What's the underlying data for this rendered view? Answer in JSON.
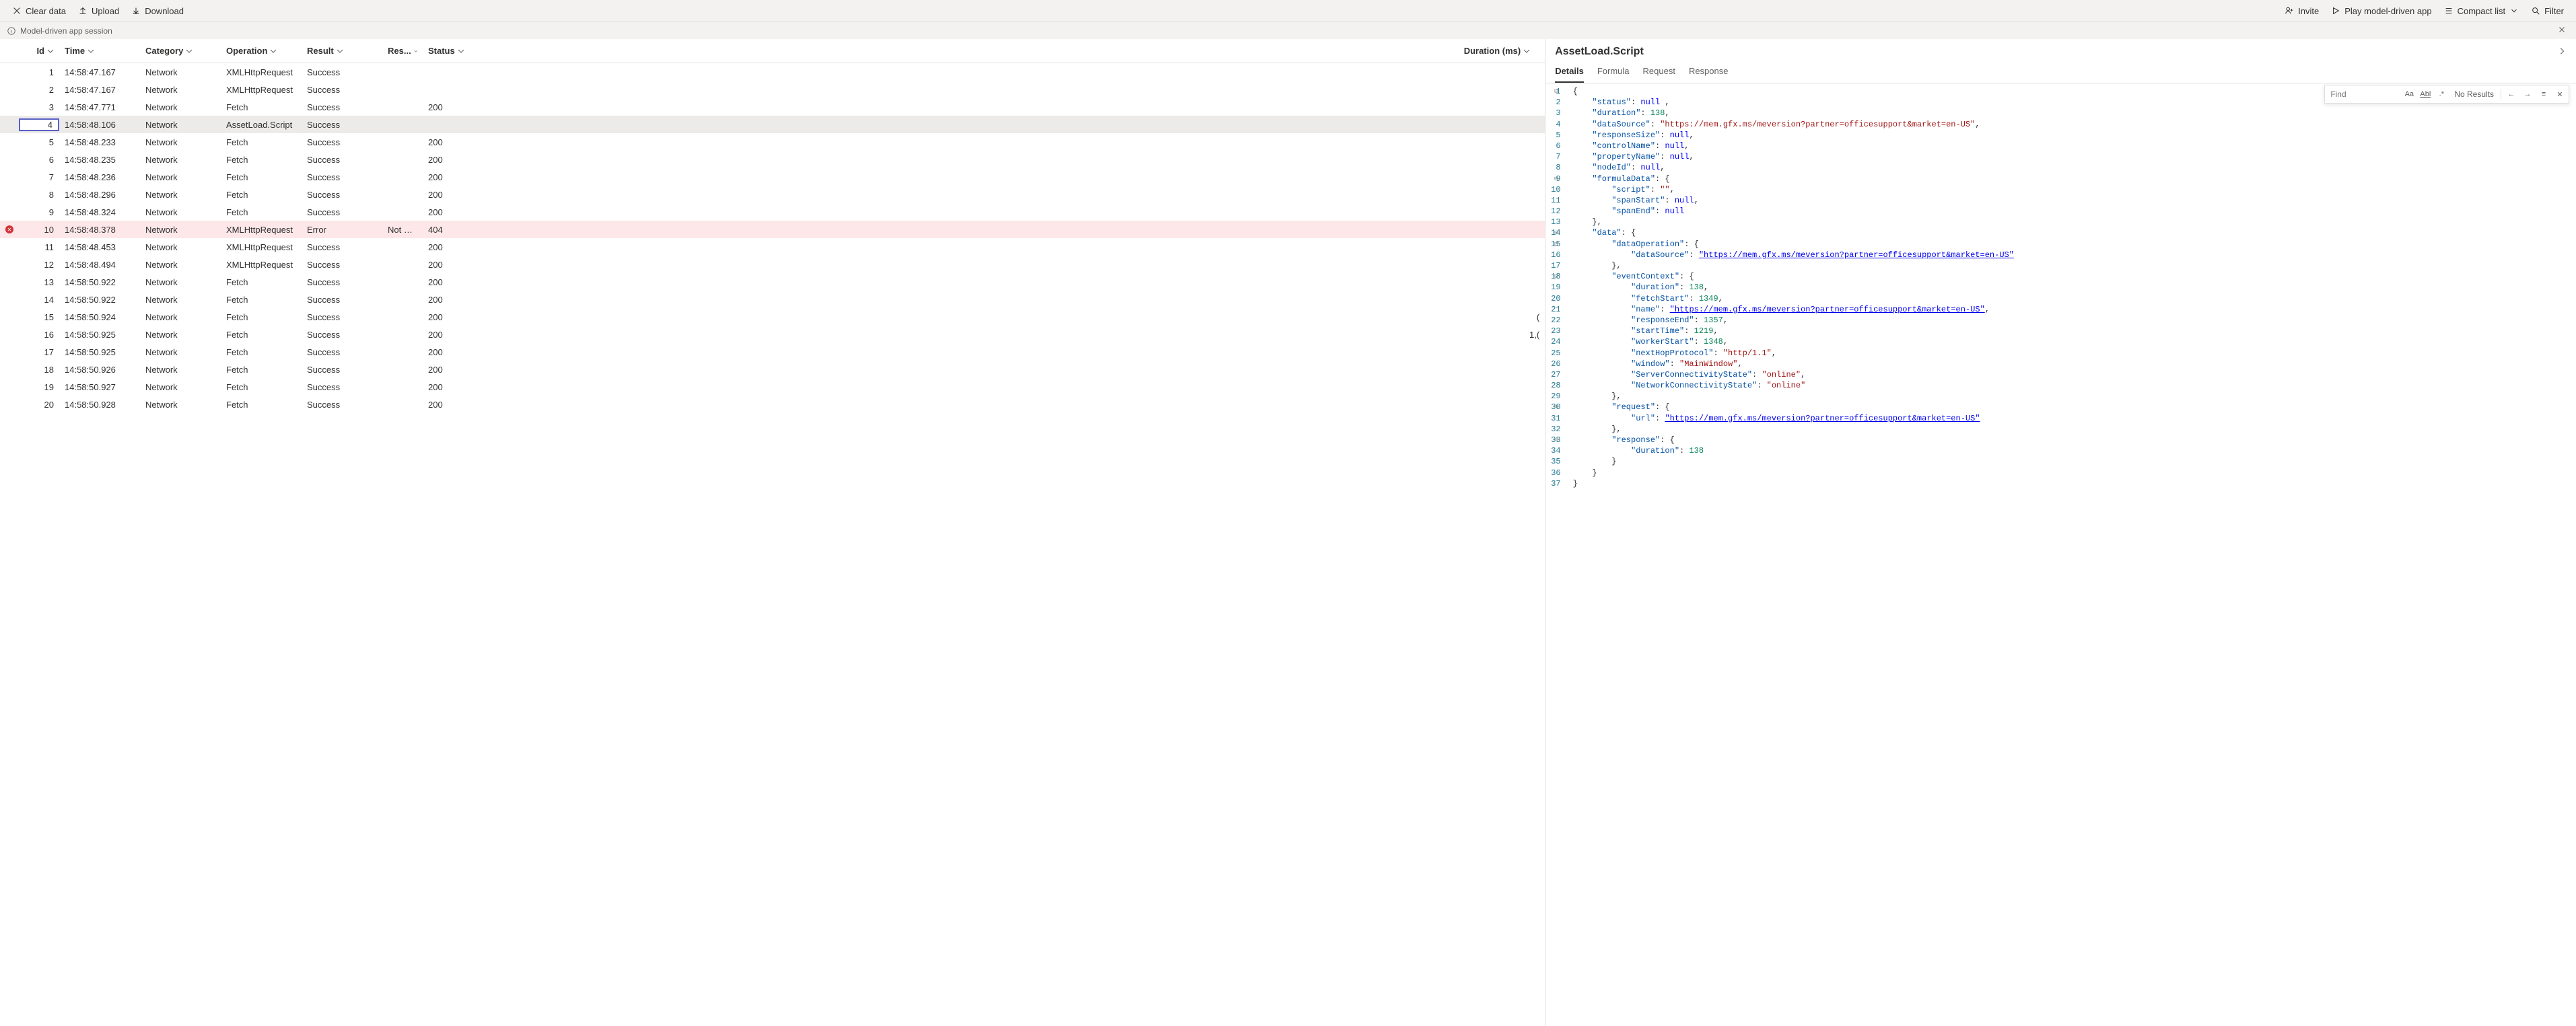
{
  "toolbar": {
    "clear": "Clear data",
    "upload": "Upload",
    "download": "Download",
    "invite": "Invite",
    "play": "Play model-driven app",
    "compact": "Compact list",
    "filter": "Filter"
  },
  "session": {
    "label": "Model-driven app session"
  },
  "columns": {
    "id": "Id",
    "time": "Time",
    "category": "Category",
    "operation": "Operation",
    "result": "Result",
    "res": "Res...",
    "status": "Status",
    "duration": "Duration (ms)"
  },
  "rows": [
    {
      "id": 1,
      "time": "14:58:47.167",
      "category": "Network",
      "operation": "XMLHttpRequest",
      "result": "Success",
      "status": "",
      "duration": "",
      "err": false
    },
    {
      "id": 2,
      "time": "14:58:47.167",
      "category": "Network",
      "operation": "XMLHttpRequest",
      "result": "Success",
      "status": "",
      "duration": "",
      "err": false
    },
    {
      "id": 3,
      "time": "14:58:47.771",
      "category": "Network",
      "operation": "Fetch",
      "result": "Success",
      "status": "200",
      "duration": "",
      "err": false
    },
    {
      "id": 4,
      "time": "14:58:48.106",
      "category": "Network",
      "operation": "AssetLoad.Script",
      "result": "Success",
      "status": "",
      "duration": "",
      "err": false,
      "selected": true
    },
    {
      "id": 5,
      "time": "14:58:48.233",
      "category": "Network",
      "operation": "Fetch",
      "result": "Success",
      "status": "200",
      "duration": "",
      "err": false
    },
    {
      "id": 6,
      "time": "14:58:48.235",
      "category": "Network",
      "operation": "Fetch",
      "result": "Success",
      "status": "200",
      "duration": "",
      "err": false
    },
    {
      "id": 7,
      "time": "14:58:48.236",
      "category": "Network",
      "operation": "Fetch",
      "result": "Success",
      "status": "200",
      "duration": "",
      "err": false
    },
    {
      "id": 8,
      "time": "14:58:48.296",
      "category": "Network",
      "operation": "Fetch",
      "result": "Success",
      "status": "200",
      "duration": "",
      "err": false
    },
    {
      "id": 9,
      "time": "14:58:48.324",
      "category": "Network",
      "operation": "Fetch",
      "result": "Success",
      "status": "200",
      "duration": "",
      "err": false
    },
    {
      "id": 10,
      "time": "14:58:48.378",
      "category": "Network",
      "operation": "XMLHttpRequest",
      "result": "Error",
      "res": "Not Fou...",
      "status": "404",
      "duration": "",
      "err": true
    },
    {
      "id": 11,
      "time": "14:58:48.453",
      "category": "Network",
      "operation": "XMLHttpRequest",
      "result": "Success",
      "status": "200",
      "duration": "",
      "err": false
    },
    {
      "id": 12,
      "time": "14:58:48.494",
      "category": "Network",
      "operation": "XMLHttpRequest",
      "result": "Success",
      "status": "200",
      "duration": "",
      "err": false
    },
    {
      "id": 13,
      "time": "14:58:50.922",
      "category": "Network",
      "operation": "Fetch",
      "result": "Success",
      "status": "200",
      "duration": "",
      "err": false
    },
    {
      "id": 14,
      "time": "14:58:50.922",
      "category": "Network",
      "operation": "Fetch",
      "result": "Success",
      "status": "200",
      "duration": "",
      "err": false
    },
    {
      "id": 15,
      "time": "14:58:50.924",
      "category": "Network",
      "operation": "Fetch",
      "result": "Success",
      "status": "200",
      "duration": "(",
      "err": false
    },
    {
      "id": 16,
      "time": "14:58:50.925",
      "category": "Network",
      "operation": "Fetch",
      "result": "Success",
      "status": "200",
      "duration": "1,(",
      "err": false
    },
    {
      "id": 17,
      "time": "14:58:50.925",
      "category": "Network",
      "operation": "Fetch",
      "result": "Success",
      "status": "200",
      "duration": "",
      "err": false
    },
    {
      "id": 18,
      "time": "14:58:50.926",
      "category": "Network",
      "operation": "Fetch",
      "result": "Success",
      "status": "200",
      "duration": "",
      "err": false
    },
    {
      "id": 19,
      "time": "14:58:50.927",
      "category": "Network",
      "operation": "Fetch",
      "result": "Success",
      "status": "200",
      "duration": "",
      "err": false
    },
    {
      "id": 20,
      "time": "14:58:50.928",
      "category": "Network",
      "operation": "Fetch",
      "result": "Success",
      "status": "200",
      "duration": "",
      "err": false
    }
  ],
  "detail": {
    "title": "AssetLoad.Script",
    "tabs": {
      "details": "Details",
      "formula": "Formula",
      "request": "Request",
      "response": "Response"
    },
    "find_placeholder": "Find",
    "find_results": "No Results",
    "code": [
      {
        "n": 1,
        "fold": "-",
        "t": [
          [
            "",
            "{"
          ]
        ]
      },
      {
        "n": 2,
        "t": [
          [
            "    "
          ],
          [
            "k",
            "\"status\""
          ],
          [
            ": "
          ],
          [
            "l",
            "null"
          ],
          [
            ",",
            " ,"
          ]
        ]
      },
      {
        "n": 3,
        "t": [
          [
            "    "
          ],
          [
            "k",
            "\"duration\""
          ],
          [
            ": "
          ],
          [
            "n",
            "138"
          ],
          [
            ","
          ]
        ]
      },
      {
        "n": 4,
        "t": [
          [
            "    "
          ],
          [
            "k",
            "\"dataSource\""
          ],
          [
            ": "
          ],
          [
            "s",
            "\"https://mem.gfx.ms/meversion?partner=officesupport&market=en-US\""
          ],
          [
            ","
          ]
        ]
      },
      {
        "n": 5,
        "t": [
          [
            "    "
          ],
          [
            "k",
            "\"responseSize\""
          ],
          [
            ": "
          ],
          [
            "l",
            "null"
          ],
          [
            ","
          ]
        ]
      },
      {
        "n": 6,
        "t": [
          [
            "    "
          ],
          [
            "k",
            "\"controlName\""
          ],
          [
            ": "
          ],
          [
            "l",
            "null"
          ],
          [
            ","
          ]
        ]
      },
      {
        "n": 7,
        "t": [
          [
            "    "
          ],
          [
            "k",
            "\"propertyName\""
          ],
          [
            ": "
          ],
          [
            "l",
            "null"
          ],
          [
            ","
          ]
        ]
      },
      {
        "n": 8,
        "t": [
          [
            "    "
          ],
          [
            "k",
            "\"nodeId\""
          ],
          [
            ": "
          ],
          [
            "l",
            "null"
          ],
          [
            ","
          ]
        ]
      },
      {
        "n": 9,
        "fold": "-",
        "t": [
          [
            "    "
          ],
          [
            "k",
            "\"formulaData\""
          ],
          [
            ": {"
          ]
        ]
      },
      {
        "n": 10,
        "t": [
          [
            "        "
          ],
          [
            "k",
            "\"script\""
          ],
          [
            ": "
          ],
          [
            "s",
            "\"\""
          ],
          [
            ","
          ]
        ]
      },
      {
        "n": 11,
        "t": [
          [
            "        "
          ],
          [
            "k",
            "\"spanStart\""
          ],
          [
            ": "
          ],
          [
            "l",
            "null"
          ],
          [
            ","
          ]
        ]
      },
      {
        "n": 12,
        "t": [
          [
            "        "
          ],
          [
            "k",
            "\"spanEnd\""
          ],
          [
            ": "
          ],
          [
            "l",
            "null"
          ]
        ]
      },
      {
        "n": 13,
        "t": [
          [
            "    },"
          ]
        ]
      },
      {
        "n": 14,
        "fold": "-",
        "t": [
          [
            "    "
          ],
          [
            "k",
            "\"data\""
          ],
          [
            ": {"
          ]
        ]
      },
      {
        "n": 15,
        "fold": "-",
        "t": [
          [
            "        "
          ],
          [
            "k",
            "\"dataOperation\""
          ],
          [
            ": {"
          ]
        ]
      },
      {
        "n": 16,
        "t": [
          [
            "            "
          ],
          [
            "k",
            "\"dataSource\""
          ],
          [
            ": "
          ],
          [
            "u",
            "\"https://mem.gfx.ms/meversion?partner=officesupport&market=en-US\""
          ]
        ]
      },
      {
        "n": 17,
        "t": [
          [
            "        },"
          ]
        ]
      },
      {
        "n": 18,
        "fold": "-",
        "t": [
          [
            "        "
          ],
          [
            "k",
            "\"eventContext\""
          ],
          [
            ": {"
          ]
        ]
      },
      {
        "n": 19,
        "t": [
          [
            "            "
          ],
          [
            "k",
            "\"duration\""
          ],
          [
            ": "
          ],
          [
            "n",
            "138"
          ],
          [
            ","
          ]
        ]
      },
      {
        "n": 20,
        "t": [
          [
            "            "
          ],
          [
            "k",
            "\"fetchStart\""
          ],
          [
            ": "
          ],
          [
            "n",
            "1349"
          ],
          [
            ","
          ]
        ]
      },
      {
        "n": 21,
        "t": [
          [
            "            "
          ],
          [
            "k",
            "\"name\""
          ],
          [
            ": "
          ],
          [
            "u",
            "\"https://mem.gfx.ms/meversion?partner=officesupport&market=en-US\""
          ],
          [
            ","
          ]
        ]
      },
      {
        "n": 22,
        "t": [
          [
            "            "
          ],
          [
            "k",
            "\"responseEnd\""
          ],
          [
            ": "
          ],
          [
            "n",
            "1357"
          ],
          [
            ","
          ]
        ]
      },
      {
        "n": 23,
        "t": [
          [
            "            "
          ],
          [
            "k",
            "\"startTime\""
          ],
          [
            ": "
          ],
          [
            "n",
            "1219"
          ],
          [
            ","
          ]
        ]
      },
      {
        "n": 24,
        "t": [
          [
            "            "
          ],
          [
            "k",
            "\"workerStart\""
          ],
          [
            ": "
          ],
          [
            "n",
            "1348"
          ],
          [
            ","
          ]
        ]
      },
      {
        "n": 25,
        "t": [
          [
            "            "
          ],
          [
            "k",
            "\"nextHopProtocol\""
          ],
          [
            ": "
          ],
          [
            "s",
            "\"http/1.1\""
          ],
          [
            ","
          ]
        ]
      },
      {
        "n": 26,
        "t": [
          [
            "            "
          ],
          [
            "k",
            "\"window\""
          ],
          [
            ": "
          ],
          [
            "s",
            "\"MainWindow\""
          ],
          [
            ","
          ]
        ]
      },
      {
        "n": 27,
        "t": [
          [
            "            "
          ],
          [
            "k",
            "\"ServerConnectivityState\""
          ],
          [
            ": "
          ],
          [
            "s",
            "\"online\""
          ],
          [
            ","
          ]
        ]
      },
      {
        "n": 28,
        "t": [
          [
            "            "
          ],
          [
            "k",
            "\"NetworkConnectivityState\""
          ],
          [
            ": "
          ],
          [
            "s",
            "\"online\""
          ]
        ]
      },
      {
        "n": 29,
        "t": [
          [
            "        },"
          ]
        ]
      },
      {
        "n": 30,
        "fold": "-",
        "t": [
          [
            "        "
          ],
          [
            "k",
            "\"request\""
          ],
          [
            ": {"
          ]
        ]
      },
      {
        "n": 31,
        "t": [
          [
            "            "
          ],
          [
            "k",
            "\"url\""
          ],
          [
            ": "
          ],
          [
            "u",
            "\"https://mem.gfx.ms/meversion?partner=officesupport&market=en-US\""
          ]
        ]
      },
      {
        "n": 32,
        "t": [
          [
            "        },"
          ]
        ]
      },
      {
        "n": 33,
        "fold": "-",
        "t": [
          [
            "        "
          ],
          [
            "k",
            "\"response\""
          ],
          [
            ": {"
          ]
        ]
      },
      {
        "n": 34,
        "t": [
          [
            "            "
          ],
          [
            "k",
            "\"duration\""
          ],
          [
            ": "
          ],
          [
            "n",
            "138"
          ]
        ]
      },
      {
        "n": 35,
        "t": [
          [
            "        }"
          ]
        ]
      },
      {
        "n": 36,
        "t": [
          [
            "    }"
          ]
        ]
      },
      {
        "n": 37,
        "t": [
          [
            "}"
          ]
        ]
      }
    ]
  }
}
